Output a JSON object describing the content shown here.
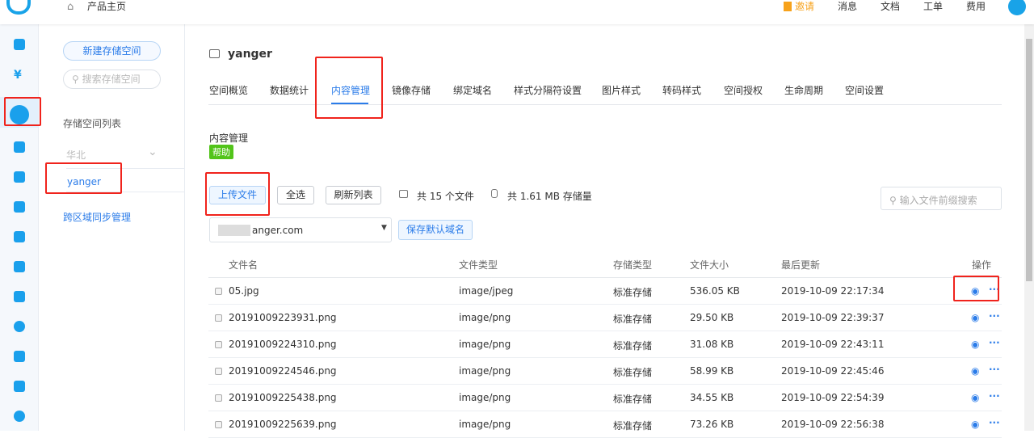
{
  "topbar": {
    "home_label": "产品主页",
    "invite": "邀请",
    "links": [
      "消息",
      "文档",
      "工单",
      "费用"
    ]
  },
  "sidebar": {
    "new_bucket": "新建存储空间",
    "search_placeholder": "搜索存储空间",
    "list_title": "存储空间列表",
    "region": "华北",
    "bucket": "yanger",
    "sync": "跨区域同步管理"
  },
  "bucket": {
    "name": "yanger"
  },
  "tabs": [
    "空间概览",
    "数据统计",
    "内容管理",
    "镜像存储",
    "绑定域名",
    "样式分隔符设置",
    "图片样式",
    "转码样式",
    "空间授权",
    "生命周期",
    "空间设置"
  ],
  "section": {
    "title": "内容管理",
    "help": "帮助"
  },
  "toolbar": {
    "upload": "上传文件",
    "select_all": "全选",
    "refresh": "刷新列表",
    "file_count": "共 15 个文件",
    "storage": "共 1.61 MB 存储量",
    "search_placeholder": "输入文件前缀搜索"
  },
  "domain": {
    "value": "anger.com",
    "save": "保存默认域名"
  },
  "table": {
    "headers": [
      "文件名",
      "文件类型",
      "存储类型",
      "文件大小",
      "最后更新",
      "操作"
    ],
    "rows": [
      [
        "05.jpg",
        "image/jpeg",
        "标准存储",
        "536.05 KB",
        "2019-10-09 22:17:34"
      ],
      [
        "20191009223931.png",
        "image/png",
        "标准存储",
        "29.50 KB",
        "2019-10-09 22:39:37"
      ],
      [
        "20191009224310.png",
        "image/png",
        "标准存储",
        "31.08 KB",
        "2019-10-09 22:43:11"
      ],
      [
        "20191009224546.png",
        "image/png",
        "标准存储",
        "58.99 KB",
        "2019-10-09 22:45:46"
      ],
      [
        "20191009225438.png",
        "image/png",
        "标准存储",
        "34.55 KB",
        "2019-10-09 22:54:39"
      ],
      [
        "20191009225639.png",
        "image/png",
        "标准存储",
        "73.26 KB",
        "2019-10-09 22:56:38"
      ]
    ]
  },
  "colors": {
    "accent": "#2b7ce9",
    "highlight": "#f0231c",
    "help": "#52c41a",
    "invite": "#f7a21b"
  }
}
